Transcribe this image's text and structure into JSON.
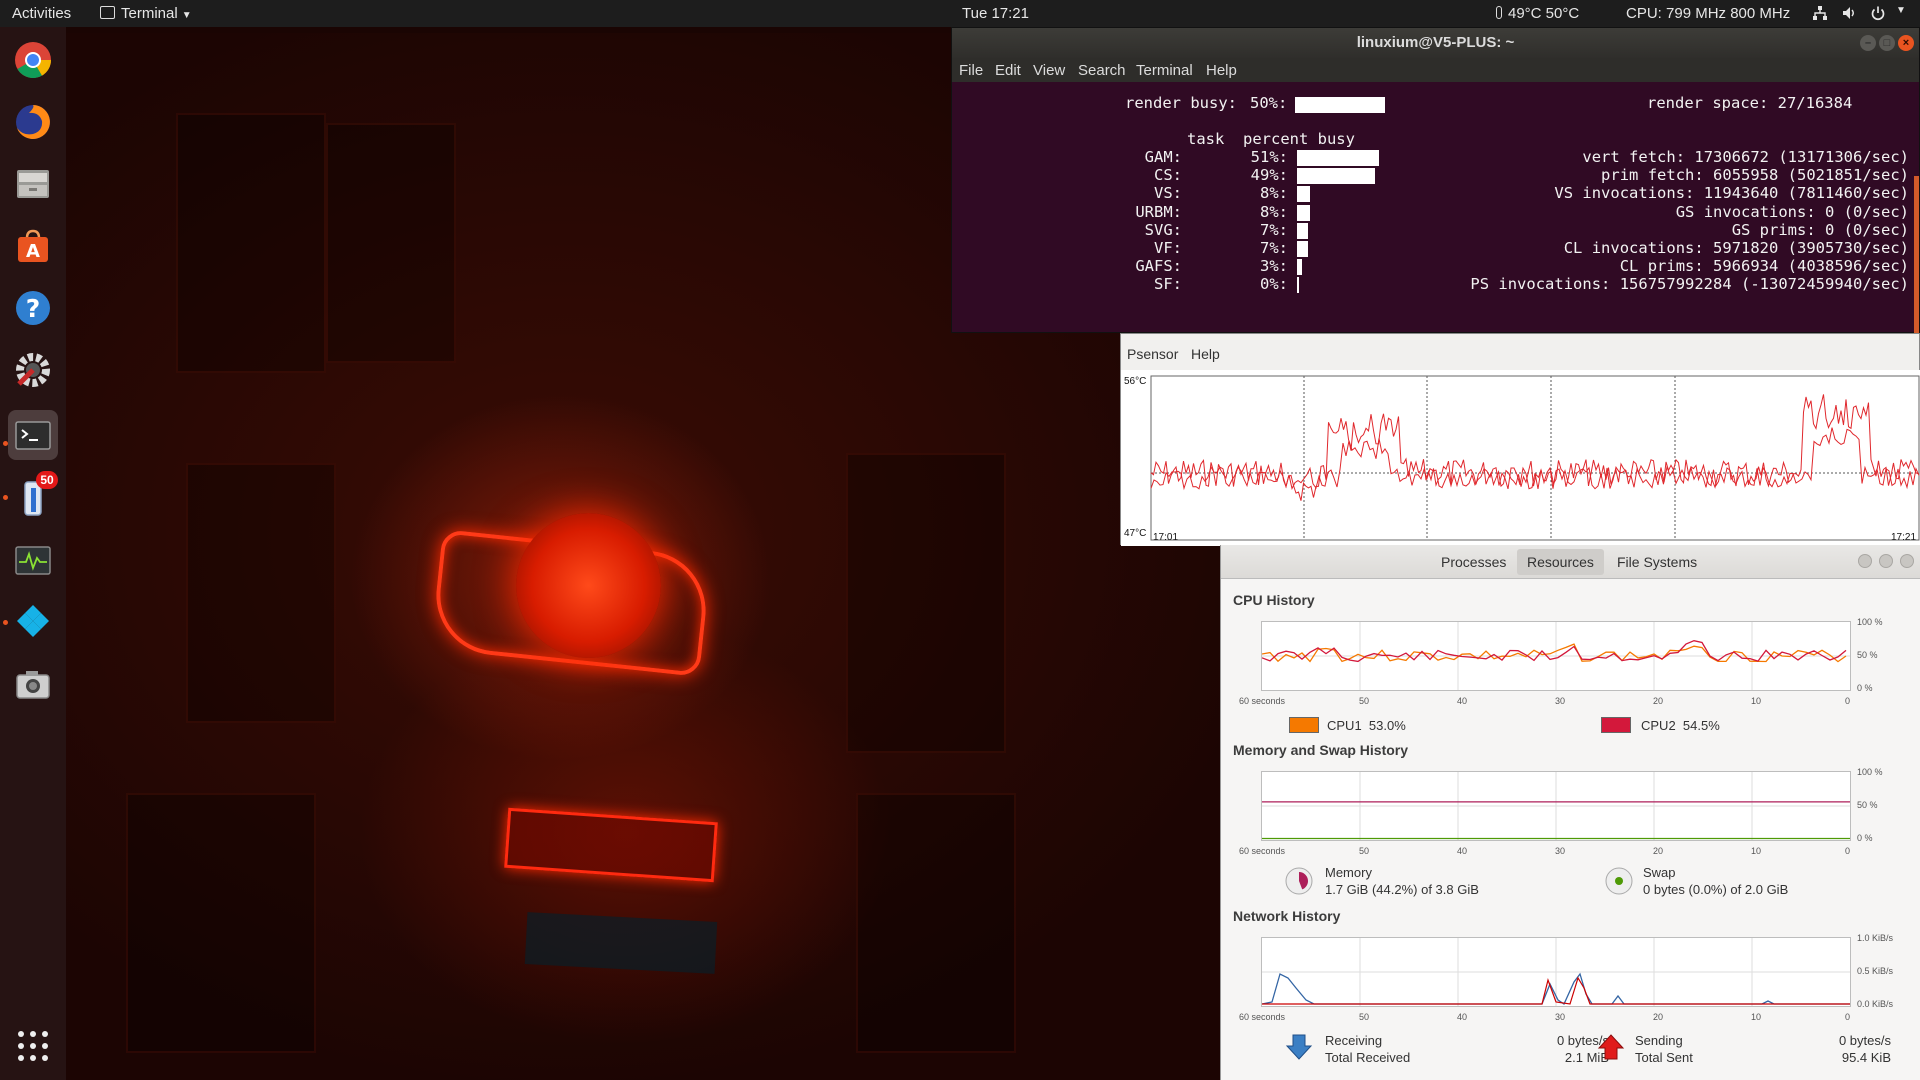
{
  "topbar": {
    "activities": "Activities",
    "app_menu": "Terminal",
    "clock": "Tue 17:21",
    "temperature": "49°C 50°C",
    "cpu_freq": "CPU: 799 MHz 800 MHz"
  },
  "dock": {
    "apps": [
      {
        "name": "chrome-icon"
      },
      {
        "name": "firefox-icon"
      },
      {
        "name": "files-icon"
      },
      {
        "name": "software-center-icon"
      },
      {
        "name": "help-icon"
      },
      {
        "name": "system-tools-icon"
      },
      {
        "name": "terminal-icon"
      },
      {
        "name": "thermometer-app-icon",
        "badge": "50"
      },
      {
        "name": "system-monitor-icon"
      },
      {
        "name": "kodi-icon"
      },
      {
        "name": "screenshot-icon"
      }
    ]
  },
  "terminal": {
    "title": "linuxium@V5-PLUS: ~",
    "menu": [
      "File",
      "Edit",
      "View",
      "Search",
      "Terminal",
      "Help"
    ],
    "render_busy_label": "render busy:",
    "render_busy_value": "50%:",
    "render_busy_fraction": 0.5,
    "render_space": "render space: 27/16384",
    "task_header": "task  percent busy",
    "tasks": [
      {
        "name": "GAM:",
        "percent": "51%:",
        "fraction": 0.51
      },
      {
        "name": "CS:",
        "percent": "49%:",
        "fraction": 0.49
      },
      {
        "name": "VS:",
        "percent": "8%:",
        "fraction": 0.08
      },
      {
        "name": "URBM:",
        "percent": "8%:",
        "fraction": 0.08
      },
      {
        "name": "SVG:",
        "percent": "7%:",
        "fraction": 0.07
      },
      {
        "name": "VF:",
        "percent": "7%:",
        "fraction": 0.07
      },
      {
        "name": "GAFS:",
        "percent": "3%:",
        "fraction": 0.03
      },
      {
        "name": "SF:",
        "percent": "0%:",
        "fraction": 0.0
      }
    ],
    "stats": [
      "vert fetch: 17306672 (13171306/sec)",
      "prim fetch: 6055958 (5021851/sec)",
      "VS invocations: 11943640 (7811460/sec)",
      "GS invocations: 0 (0/sec)",
      "GS prims: 0 (0/sec)",
      "CL invocations: 5971820 (3905730/sec)",
      "CL prims: 5966934 (4038596/sec)",
      "PS invocations: 156757992284 (-13072459940/sec)"
    ]
  },
  "psensor": {
    "menu": [
      "Psensor",
      "Help"
    ],
    "y_max": "56°C",
    "y_min": "47°C",
    "x_start": "17:01",
    "x_end": "17:21",
    "line_color": "#e0282d"
  },
  "sysmon": {
    "tabs": [
      "Processes",
      "Resources",
      "File Systems"
    ],
    "active_tab": "Resources",
    "cpu": {
      "title": "CPU History",
      "y_labels": [
        "100 %",
        "50 %",
        "0 %"
      ],
      "x_labels": [
        "60 seconds",
        "50",
        "40",
        "30",
        "20",
        "10",
        "0"
      ],
      "cpu1_label": "CPU1",
      "cpu1_value": "53.0%",
      "cpu1_color": "#f57900",
      "cpu2_label": "CPU2",
      "cpu2_value": "54.5%",
      "cpu2_color": "#d3183b"
    },
    "memory": {
      "title": "Memory and Swap History",
      "y_labels": [
        "100 %",
        "50 %",
        "0 %"
      ],
      "x_labels": [
        "60 seconds",
        "50",
        "40",
        "30",
        "20",
        "10",
        "0"
      ],
      "mem_label": "Memory",
      "mem_value": "1.7 GiB (44.2%) of 3.8 GiB",
      "mem_fraction": 0.442,
      "mem_color": "#ad1f5a",
      "swap_label": "Swap",
      "swap_value": "0 bytes (0.0%) of 2.0 GiB",
      "swap_color": "#4e9a06"
    },
    "network": {
      "title": "Network History",
      "y_labels": [
        "1.0 KiB/s",
        "0.5 KiB/s",
        "0.0 KiB/s"
      ],
      "x_labels": [
        "60 seconds",
        "50",
        "40",
        "30",
        "20",
        "10",
        "0"
      ],
      "recv_label": "Receiving",
      "recv_total_label": "Total Received",
      "recv_rate": "0 bytes/s",
      "recv_total": "2.1 MiB",
      "recv_color": "#3465a4",
      "send_label": "Sending",
      "send_total_label": "Total Sent",
      "send_rate": "0 bytes/s",
      "send_total": "95.4 KiB",
      "send_color": "#cc0000"
    }
  }
}
